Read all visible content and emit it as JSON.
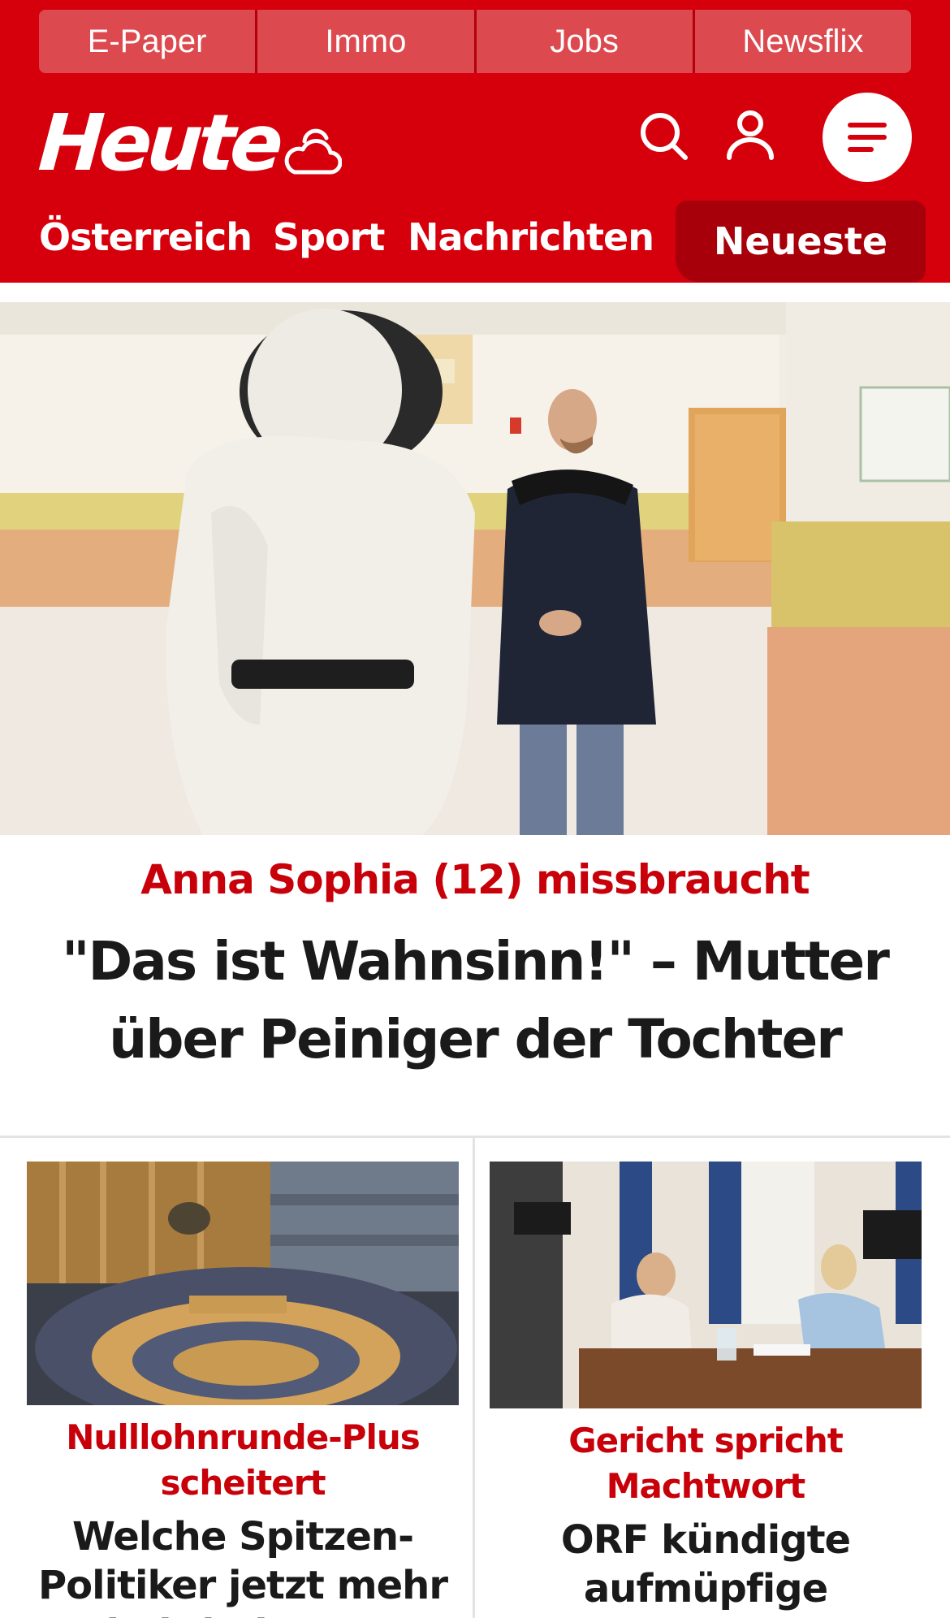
{
  "quicklinks": [
    "E-Paper",
    "Immo",
    "Jobs",
    "Newsflix"
  ],
  "brand": {
    "logo_text": "Heute"
  },
  "nav": {
    "items": [
      "Österreich",
      "Sport",
      "Nachrichten"
    ],
    "active": "Neueste"
  },
  "hero": {
    "kicker": "Anna Sophia (12) missbraucht",
    "title": "\"Das ist Wahnsinn!\" – Mutter über Peiniger der Tochter"
  },
  "teasers": [
    {
      "kicker": "Nulllohnrunde-Plus scheitert",
      "title": "Welche Spitzen-Politiker jetzt mehr Gehalt bekommen"
    },
    {
      "kicker": "Gericht spricht Machtwort",
      "title": "ORF kündigte aufmüpfige Mitarbeiterin"
    }
  ],
  "icons": {
    "weather": "cloud-sun-icon",
    "search": "search-icon",
    "user": "user-icon",
    "menu": "hamburger-menu-icon"
  },
  "colors": {
    "brand_red": "#d6000c",
    "active_tab": "#a8000a",
    "kicker_red": "#c8000a",
    "text": "#1a1a1a"
  }
}
